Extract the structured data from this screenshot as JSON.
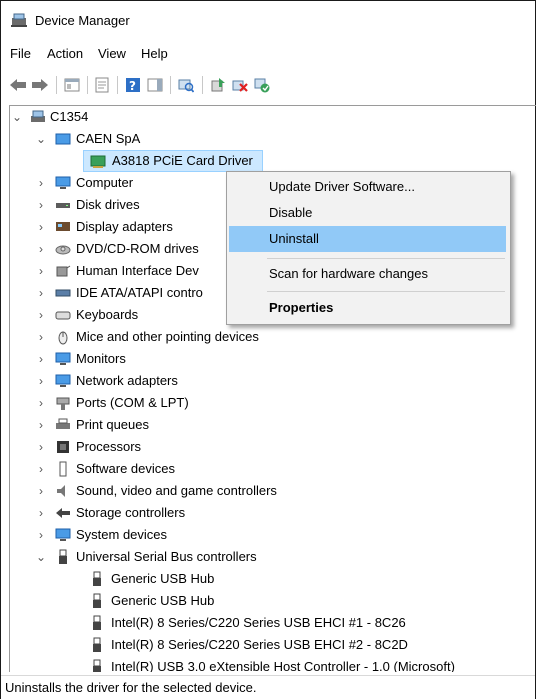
{
  "window": {
    "title": "Device Manager"
  },
  "menu": {
    "file": "File",
    "action": "Action",
    "view": "View",
    "help": "Help"
  },
  "tree": {
    "root": "C1354",
    "items": [
      "CAEN SpA",
      "A3818 PCiE Card Driver",
      "Computer",
      "Disk drives",
      "Display adapters",
      "DVD/CD-ROM drives",
      "Human Interface Dev",
      "IDE ATA/ATAPI contro",
      "Keyboards",
      "Mice and other pointing devices",
      "Monitors",
      "Network adapters",
      "Ports (COM & LPT)",
      "Print queues",
      "Processors",
      "Software devices",
      "Sound, video and game controllers",
      "Storage controllers",
      "System devices",
      "Universal Serial Bus controllers",
      "Generic USB Hub",
      "Generic USB Hub",
      "Intel(R) 8 Series/C220 Series USB EHCI #1 - 8C26",
      "Intel(R) 8 Series/C220 Series USB EHCI #2 - 8C2D",
      "Intel(R) USB 3.0 eXtensible Host Controller - 1.0 (Microsoft)"
    ]
  },
  "context_menu": {
    "update": "Update Driver Software...",
    "disable": "Disable",
    "uninstall": "Uninstall",
    "scan": "Scan for hardware changes",
    "properties": "Properties"
  },
  "status_bar": {
    "text": "Uninstalls the driver for the selected device."
  },
  "colors": {
    "selection": "#cce8ff",
    "menu_highlight": "#91c9f7",
    "device_icon_blue": "#1e73c8",
    "device_icon_green": "#3aa05a"
  }
}
